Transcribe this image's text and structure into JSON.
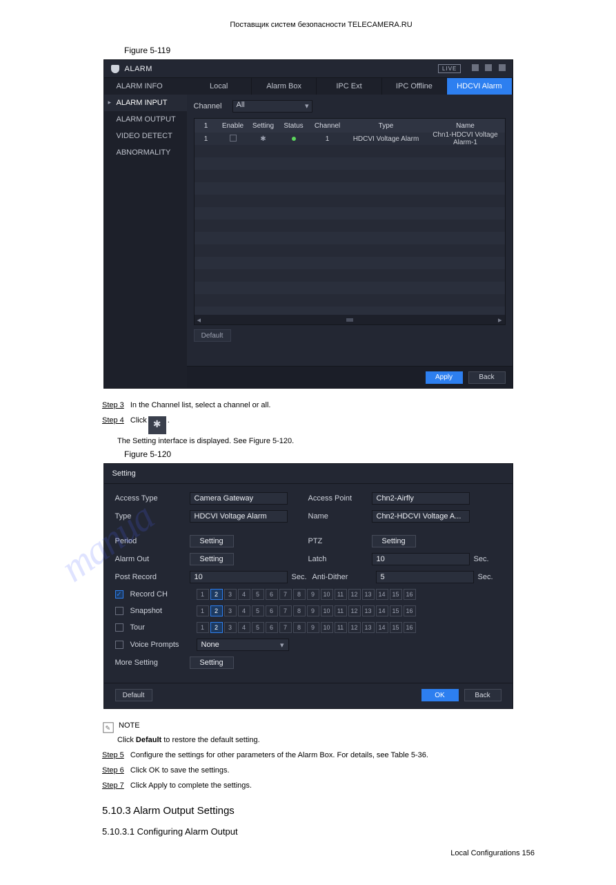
{
  "figure1": {
    "caption": "Figure 5-119"
  },
  "panel1": {
    "title": "ALARM",
    "live": "LIVE",
    "sidebar": [
      "ALARM INFO",
      "ALARM INPUT",
      "ALARM OUTPUT",
      "VIDEO DETECT",
      "ABNORMALITY"
    ],
    "sidebar_active_index": 1,
    "tabs": [
      "Local",
      "Alarm Box",
      "IPC Ext",
      "IPC Offline",
      "HDCVI Alarm"
    ],
    "tab_active_index": 4,
    "channel_label": "Channel",
    "channel_value": "All",
    "table": {
      "headers": {
        "num": "1",
        "enable": "Enable",
        "setting": "Setting",
        "status": "Status",
        "channel": "Channel",
        "type": "Type",
        "name": "Name"
      },
      "row": {
        "num": "1",
        "channel": "1",
        "type": "HDCVI Voltage Alarm",
        "name": "Chn1-HDCVI Voltage Alarm-1"
      }
    },
    "default_btn": "Default",
    "apply_btn": "Apply",
    "back_btn": "Back"
  },
  "doc1": {
    "step3_label": "Step 3",
    "step3_text": "In the Channel list, select a channel or all.",
    "step4_label": "Step 4",
    "step4_text_a": "Click ",
    "step4_text_b": ".",
    "step4_sub": "The Setting interface is displayed. See Figure 5-120."
  },
  "figure2": {
    "caption": "Figure 5-120"
  },
  "panel2": {
    "title": "Setting",
    "access_type_label": "Access Type",
    "access_type_value": "Camera Gateway",
    "access_point_label": "Access Point",
    "access_point_value": "Chn2-Airfly",
    "type_label": "Type",
    "type_value": "HDCVI Voltage Alarm",
    "name_label": "Name",
    "name_value": "Chn2-HDCVI Voltage A...",
    "period_label": "Period",
    "ptz_label": "PTZ",
    "alarm_out_label": "Alarm Out",
    "latch_label": "Latch",
    "latch_value": "10",
    "post_record_label": "Post Record",
    "post_record_value": "10",
    "anti_dither_label": "Anti-Dither",
    "anti_dither_value": "5",
    "sec": "Sec.",
    "setting_btn": "Setting",
    "record_ch_label": "Record CH",
    "snapshot_label": "Snapshot",
    "tour_label": "Tour",
    "voice_label": "Voice Prompts",
    "voice_value": "None",
    "more_label": "More Setting",
    "default_btn": "Default",
    "ok_btn": "OK",
    "back_btn": "Back",
    "channels": [
      "1",
      "2",
      "3",
      "4",
      "5",
      "6",
      "7",
      "8",
      "9",
      "10",
      "11",
      "12",
      "13",
      "14",
      "15",
      "16"
    ],
    "channel_selected_index": 1
  },
  "doc2": {
    "step5_label": "Step 5",
    "step5_text": "Configure the settings for other parameters of the Alarm Box. For details, see Table 5-36.",
    "step6_label": "Step 6",
    "step6_text": "Click OK to save the settings.",
    "step7_label": "Step 7",
    "step7_text": "Click Apply to complete the settings.",
    "section_no": "5.10.3",
    "section_title": "Alarm Output Settings",
    "subsection_no": "5.10.3.1",
    "subsection_title": "Configuring Alarm Output",
    "manual_title": "Поставщик систем безопасности TELECAMERA.RU",
    "page_number": "Local Configurations  156"
  },
  "watermark": "manualshive.com"
}
